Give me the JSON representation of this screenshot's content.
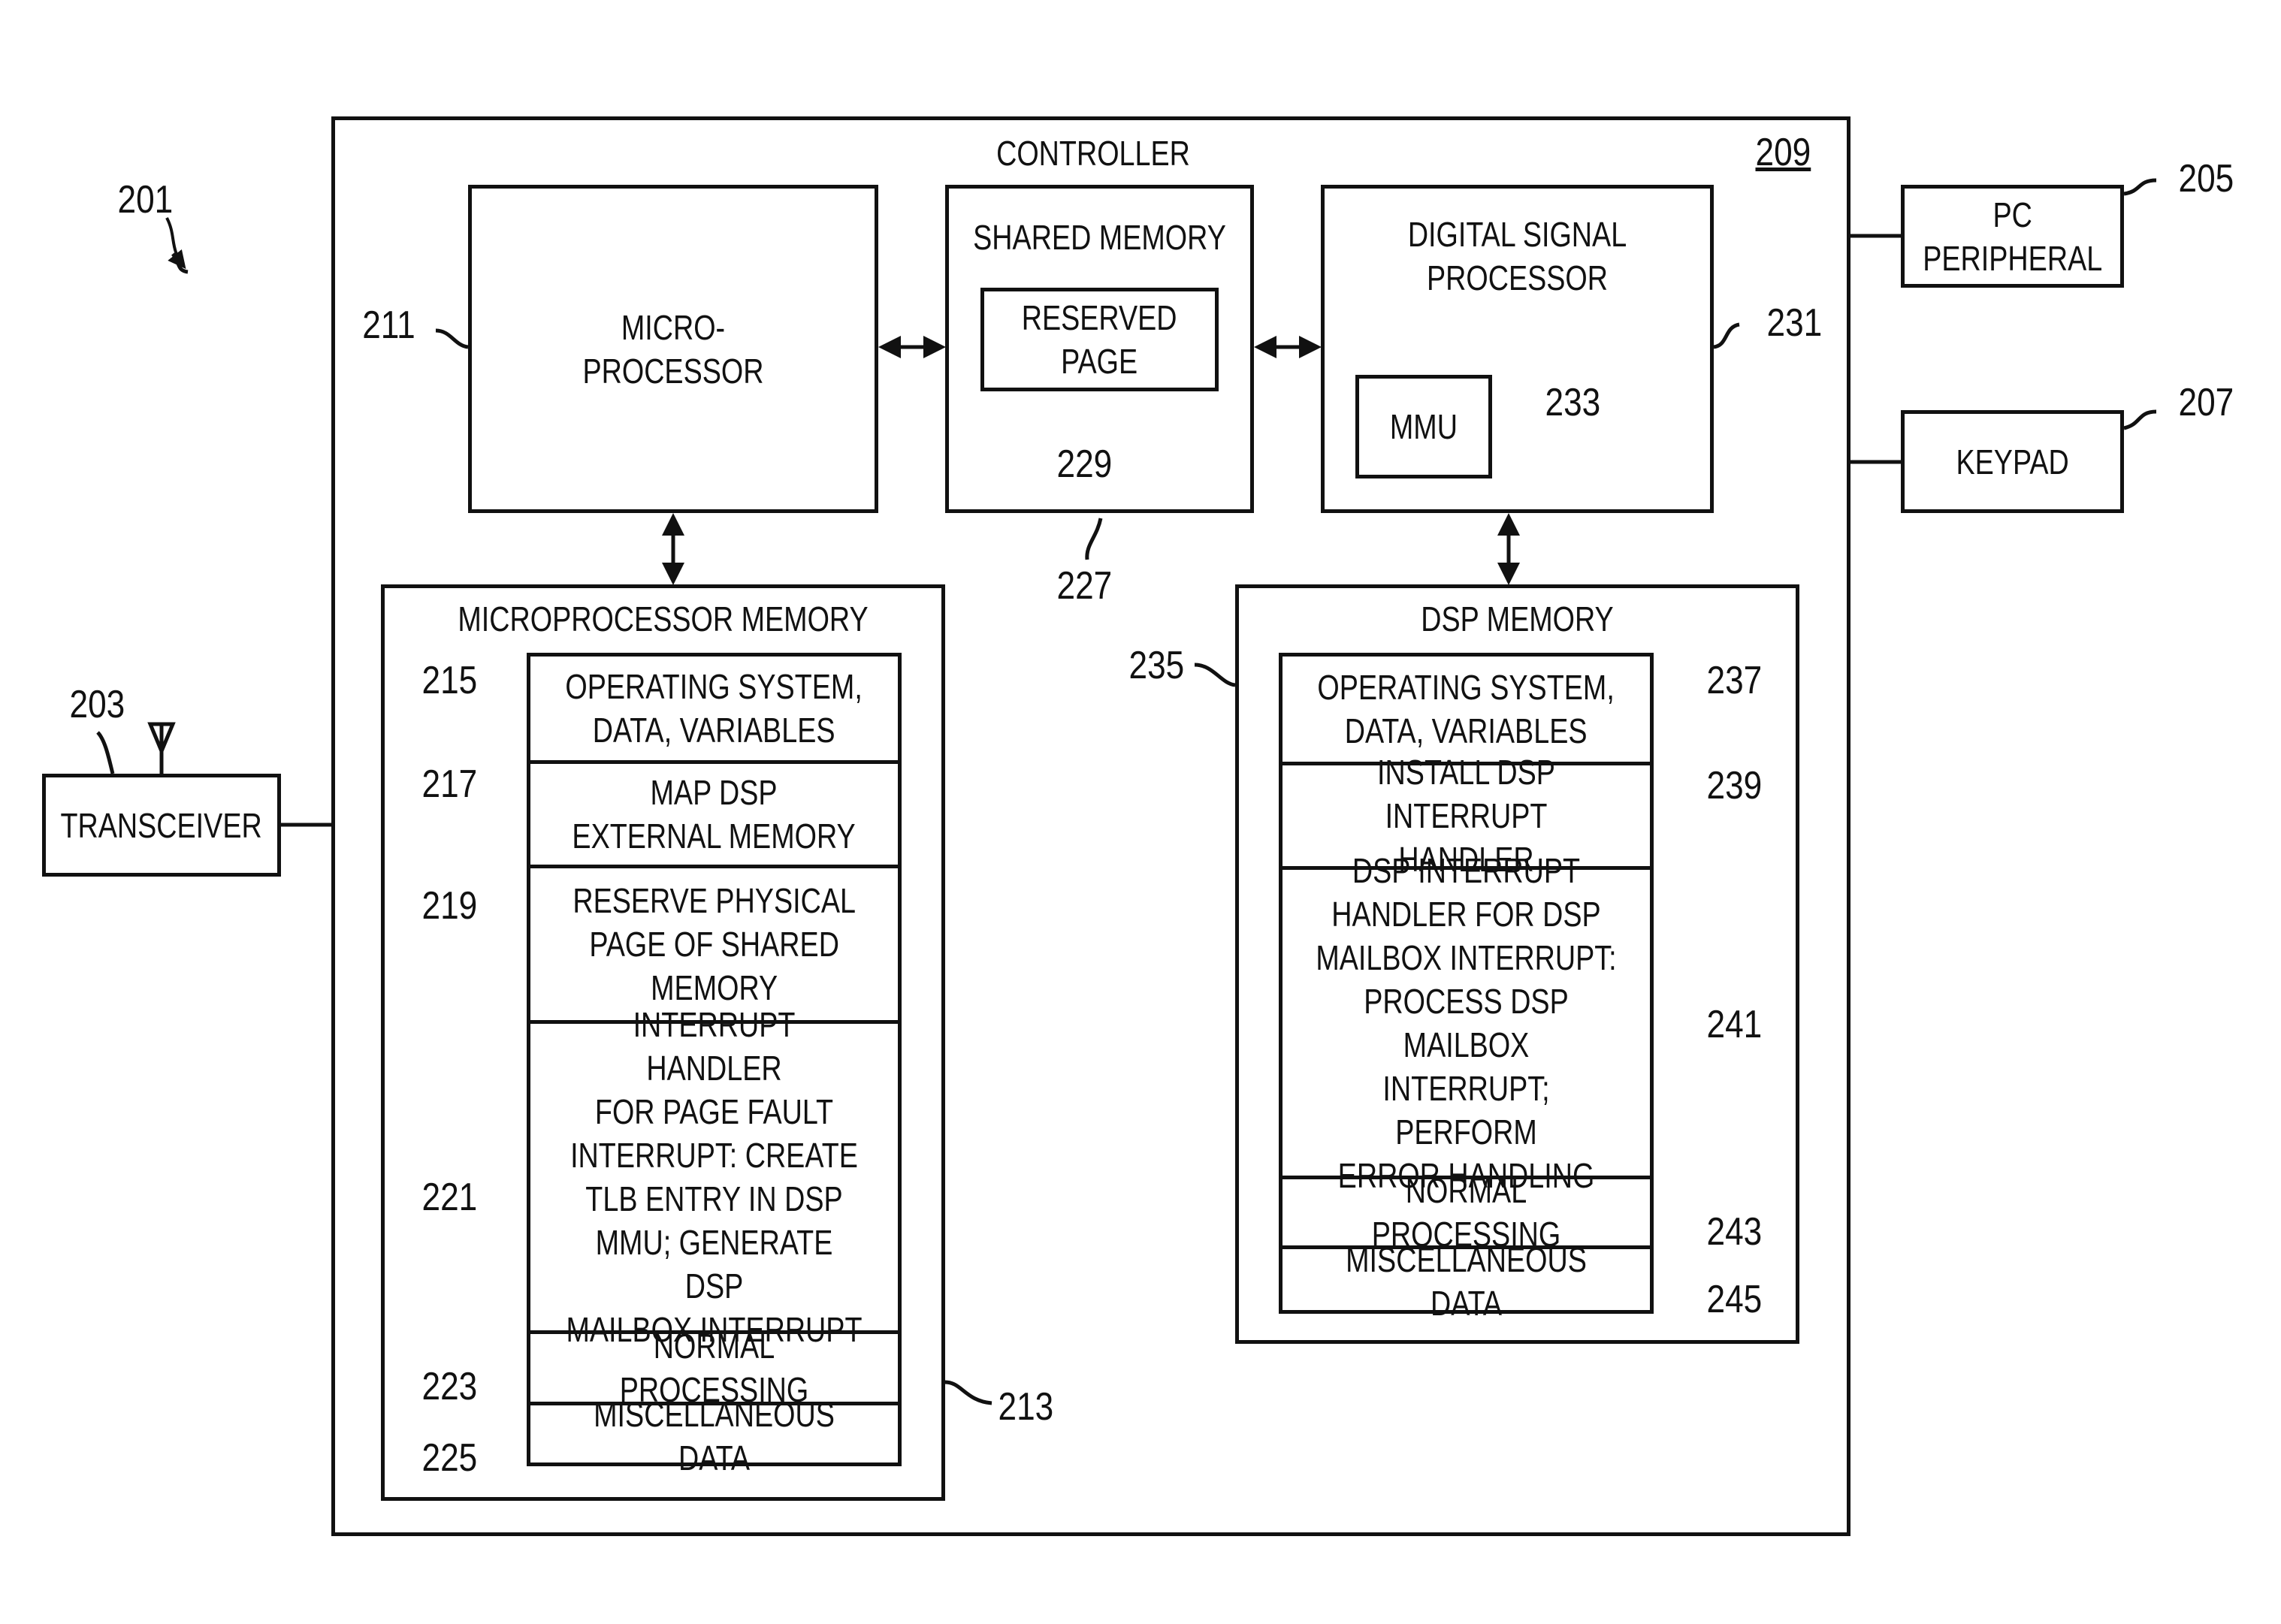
{
  "figure_ref": "201",
  "controller": {
    "title": "CONTROLLER",
    "ref": "209"
  },
  "microprocessor": {
    "label": "MICRO-\nPROCESSOR",
    "ref": "211"
  },
  "shared_memory": {
    "title": "SHARED MEMORY",
    "ref": "227",
    "reserved_page": {
      "label": "RESERVED\nPAGE",
      "ref": "229"
    }
  },
  "dsp": {
    "label": "DIGITAL SIGNAL\nPROCESSOR",
    "ref": "231",
    "mmu": {
      "label": "MMU",
      "ref": "233"
    }
  },
  "pc_peripheral": {
    "label": "PC\nPERIPHERAL",
    "ref": "205"
  },
  "keypad": {
    "label": "KEYPAD",
    "ref": "207"
  },
  "transceiver": {
    "label": "TRANSCEIVER",
    "ref": "203"
  },
  "mp_memory": {
    "title": "MICROPROCESSOR MEMORY",
    "ref": "213",
    "rows": [
      {
        "text": "OPERATING SYSTEM,\nDATA, VARIABLES",
        "ref": "215"
      },
      {
        "text": "MAP DSP\nEXTERNAL MEMORY",
        "ref": "217"
      },
      {
        "text": "RESERVE PHYSICAL\nPAGE OF SHARED\nMEMORY",
        "ref": "219"
      },
      {
        "text": "INTERRUPT HANDLER\nFOR PAGE FAULT\nINTERRUPT: CREATE\nTLB ENTRY IN DSP\nMMU; GENERATE DSP\nMAILBOX INTERRUPT",
        "ref": "221"
      },
      {
        "text": "NORMAL PROCESSING",
        "ref": "223"
      },
      {
        "text": "MISCELLANEOUS DATA",
        "ref": "225"
      }
    ]
  },
  "dsp_memory": {
    "title": "DSP MEMORY",
    "ref": "235",
    "rows": [
      {
        "text": "OPERATING SYSTEM,\nDATA, VARIABLES",
        "ref": "237"
      },
      {
        "text": "INSTALL DSP\nINTERRUPT HANDLER",
        "ref": "239"
      },
      {
        "text": "DSP INTERRUPT\nHANDLER FOR DSP\nMAILBOX INTERRUPT:\nPROCESS DSP MAILBOX\nINTERRUPT; PERFORM\nERROR HANDLING",
        "ref": "241"
      },
      {
        "text": "NORMAL PROCESSING",
        "ref": "243"
      },
      {
        "text": "MISCELLANEOUS DATA",
        "ref": "245"
      }
    ]
  }
}
